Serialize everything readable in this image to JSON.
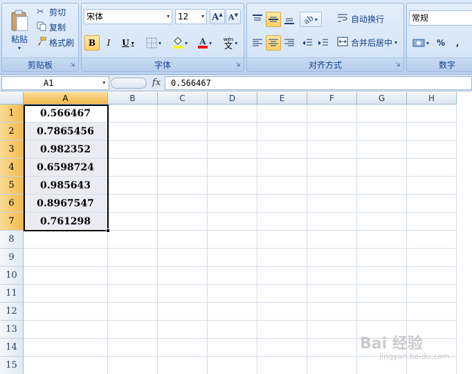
{
  "ribbon": {
    "clipboard": {
      "paste_label": "粘贴",
      "cut_label": "剪切",
      "copy_label": "复制",
      "format_painter_label": "格式刷",
      "group_label": "剪贴板"
    },
    "font": {
      "font_name": "宋体",
      "font_size": "12",
      "bold": "B",
      "italic": "I",
      "underline": "U",
      "group_label": "字体"
    },
    "alignment": {
      "wrap_text_label": "自动换行",
      "merge_center_label": "合并后居中",
      "group_label": "对齐方式"
    },
    "number": {
      "format": "常规",
      "percent": "%",
      "comma": ",",
      "group_label": "数字"
    }
  },
  "formula_bar": {
    "name_box": "A1",
    "fx": "fx",
    "formula": "0.566467"
  },
  "columns": [
    "A",
    "B",
    "C",
    "D",
    "E",
    "F",
    "G",
    "H"
  ],
  "rows": [
    "1",
    "2",
    "3",
    "4",
    "5",
    "6",
    "7",
    "8",
    "9",
    "10",
    "11",
    "12",
    "13",
    "14",
    "15"
  ],
  "cells": {
    "A": [
      "0.566467",
      "0.7865456",
      "0.982352",
      "0.6598724",
      "0.985643",
      "0.8967547",
      "0.761298"
    ]
  },
  "colors": {
    "selected_header": "#f2b94d",
    "selection_fill": "#ebebf2",
    "ribbon_text": "#15428b"
  },
  "watermark": {
    "main": "Bai 经验",
    "sub": "jingyan.baidu.com"
  }
}
